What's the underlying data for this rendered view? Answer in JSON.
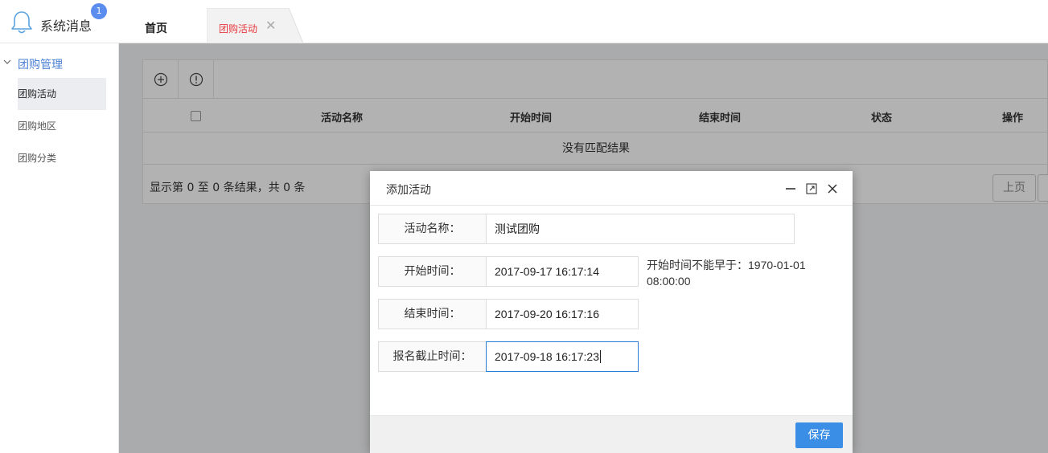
{
  "topbar": {
    "system_message": "系统消息",
    "badge_count": "1",
    "tabs": [
      {
        "label": "首页"
      },
      {
        "label": "团购活动",
        "active": true
      }
    ]
  },
  "sidebar": {
    "group_label": "团购管理",
    "items": [
      {
        "label": "团购活动",
        "active": true
      },
      {
        "label": "团购地区"
      },
      {
        "label": "团购分类"
      }
    ]
  },
  "table": {
    "columns": [
      "活动名称",
      "开始时间",
      "结束时间",
      "状态",
      "操作"
    ],
    "empty_text": "没有匹配结果",
    "footer_info": "显示第 0 至 0 条结果，共 0 条",
    "prev_label": "上页"
  },
  "modal": {
    "title": "添加活动",
    "fields": [
      {
        "label": "活动名称：",
        "value": "测试团购"
      },
      {
        "label": "开始时间：",
        "value": "2017-09-17 16:17:14"
      },
      {
        "label": "结束时间：",
        "value": "2017-09-20 16:17:16"
      },
      {
        "label": "报名截止时间：",
        "value": "2017-09-18 16:17:23"
      }
    ],
    "hint": "开始时间不能早于：1970-01-01 08:00:00",
    "save_label": "保存"
  },
  "colors": {
    "accent": "#3a8ee6",
    "active_tab_text": "#e8383d",
    "sidebar_group": "#4a7fd6",
    "badge": "#5b8def"
  }
}
